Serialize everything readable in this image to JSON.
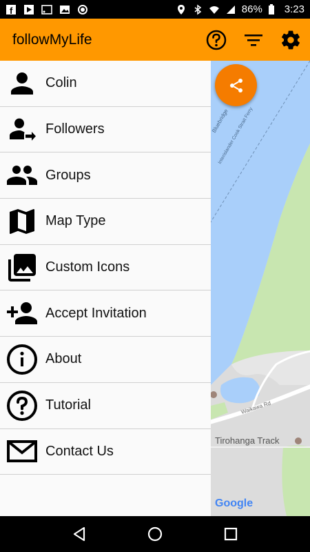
{
  "status_bar": {
    "battery": "86%",
    "time": "3:23",
    "icons_left": [
      "facebook-icon",
      "play-store-icon",
      "cast-icon",
      "image-icon",
      "circle-icon"
    ],
    "icons_right": [
      "location-icon",
      "bluetooth-icon",
      "wifi-icon",
      "signal-icon",
      "battery-icon"
    ]
  },
  "app_bar": {
    "title": "followMyLife",
    "actions": [
      "help-icon",
      "filter-icon",
      "settings-icon"
    ]
  },
  "drawer": {
    "items": [
      {
        "label": "Colin",
        "icon": "person-icon"
      },
      {
        "label": "Followers",
        "icon": "followers-icon"
      },
      {
        "label": "Groups",
        "icon": "groups-icon"
      },
      {
        "label": "Map Type",
        "icon": "map-icon"
      },
      {
        "label": "Custom Icons",
        "icon": "photo-library-icon"
      },
      {
        "label": "Accept Invitation",
        "icon": "add-person-icon"
      },
      {
        "label": "About",
        "icon": "info-icon"
      },
      {
        "label": "Tutorial",
        "icon": "help-circle-icon"
      },
      {
        "label": "Contact Us",
        "icon": "mail-icon"
      }
    ]
  },
  "map": {
    "labels": {
      "street1": "Bluebridge",
      "street2": "Interislander Cook Strait Ferry",
      "road": "Waikawa Rd",
      "place": "Tirohanga Track",
      "attribution": "Google"
    },
    "colors": {
      "water": "#a9cffa",
      "park": "#c8e6b0",
      "land": "#e6e6e6",
      "road": "#ffffff"
    }
  },
  "nav_bar": {
    "buttons": [
      "back-icon",
      "home-icon",
      "recents-icon"
    ]
  },
  "colors": {
    "primary": "#ff9800",
    "fab": "#f57c00"
  }
}
